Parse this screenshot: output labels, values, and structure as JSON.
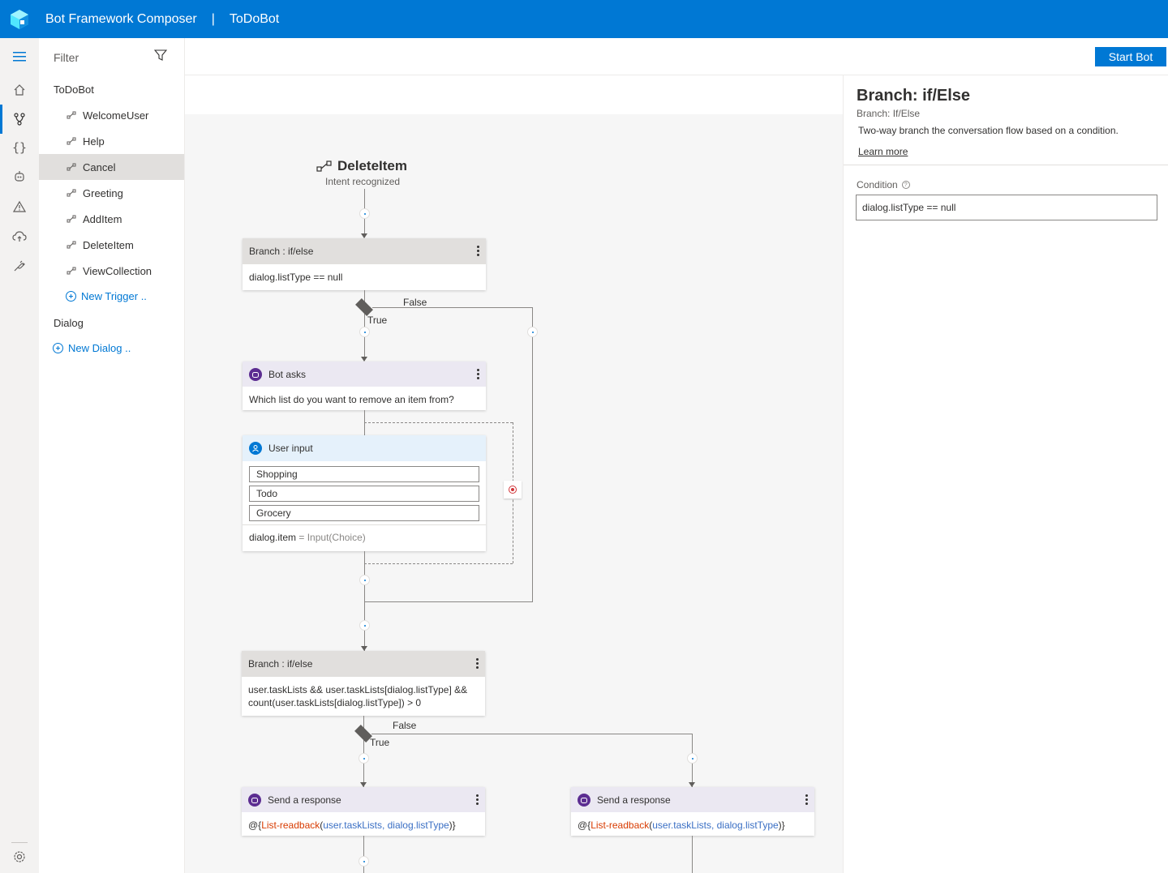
{
  "header": {
    "app_title": "Bot Framework Composer",
    "separator": "|",
    "project_title": "ToDoBot"
  },
  "leftnav": {
    "items": [
      "hamburger-icon",
      "home-icon",
      "design-flow-icon",
      "lu-braces-icon",
      "bot-icon",
      "warning-icon",
      "cloud-publish-icon",
      "plug-icon"
    ],
    "footer": "settings-icon"
  },
  "tree": {
    "filter_placeholder": "Filter",
    "root": "ToDoBot",
    "triggers": [
      "WelcomeUser",
      "Help",
      "Cancel",
      "Greeting",
      "AddItem",
      "DeleteItem",
      "ViewCollection"
    ],
    "selected": "Cancel",
    "new_trigger": "New Trigger ..",
    "dialog_section": "Dialog",
    "new_dialog": "New Dialog .."
  },
  "toolbar": {
    "start_bot": "Start Bot"
  },
  "canvas": {
    "trigger_name": "DeleteItem",
    "trigger_sub": "Intent recognized",
    "branch1": {
      "title": "Branch : if/else",
      "condition": "dialog.listType == null",
      "false_label": "False",
      "true_label": "True"
    },
    "bot_asks": {
      "title": "Bot asks",
      "text": "Which list do you want to remove an item from?"
    },
    "user_input": {
      "title": "User input",
      "choices": [
        "Shopping",
        "Todo",
        "Grocery"
      ],
      "property": "dialog.item",
      "assign": "= Input(Choice)"
    },
    "branch2": {
      "title": "Branch : if/else",
      "condition_line1": "user.taskLists && user.taskLists[dialog.listType] &&",
      "condition_line2": "count(user.taskLists[dialog.listType]) > 0",
      "false_label": "False",
      "true_label": "True"
    },
    "send1": {
      "title": "Send a response",
      "prefix": "@{",
      "fn": "List-readback",
      "open": "(",
      "arg1": "user.taskLists",
      "comma": ", ",
      "arg2": "dialog.listType",
      "close": ")}"
    },
    "send2": {
      "title": "Send a response",
      "prefix": "@{",
      "fn": "List-readback",
      "open": "(",
      "arg1": "user.taskLists",
      "comma": ", ",
      "arg2": "dialog.listType",
      "close": ")}"
    }
  },
  "properties": {
    "title": "Branch: if/Else",
    "subtitle": "Branch: If/Else",
    "description": "Two-way branch the conversation flow based on a condition.",
    "learn_more": "Learn more",
    "condition_label": "Condition",
    "condition_value": "dialog.listType == null"
  },
  "colors": {
    "brand": "#0078d4",
    "lg_function": "#d83b01",
    "lg_argument": "#3a6fc4"
  }
}
